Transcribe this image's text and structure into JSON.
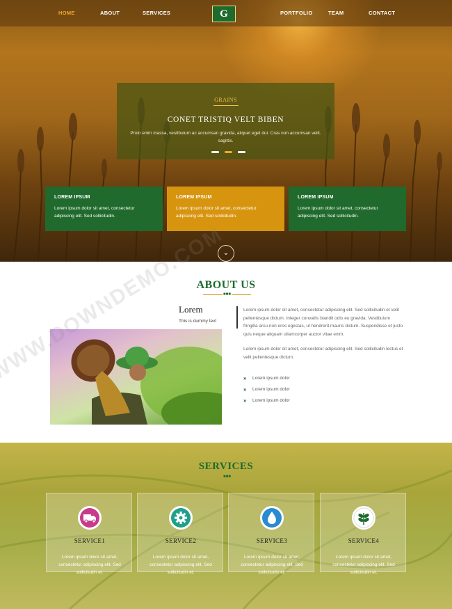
{
  "nav": {
    "items": [
      {
        "label": "HOME",
        "active": true
      },
      {
        "label": "ABOUT"
      },
      {
        "label": "SERVICES"
      },
      {
        "label": "PORTFOLIO"
      },
      {
        "label": "TEAM"
      },
      {
        "label": "CONTACT"
      }
    ],
    "logo_letter": "G"
  },
  "hero": {
    "kicker": "GRAINS",
    "title": "CONET TRISTIQ VELT BIBEN",
    "text": "Proin enim massa, vestibulum ac accumsan gravida, aliquet eget dui. Cras non accumsan velit. sagittis.",
    "slides": 3,
    "active_slide": 2
  },
  "features": [
    {
      "title": "LOREM IPSUM",
      "text": "Lorem ipsum dolor sit amet, consectetur adipiscing elit. Sed sollicitudin.",
      "color": "#1f6a2c"
    },
    {
      "title": "LOREM IPSUM",
      "text": "Lorem ipsum dolor sit amet, consectetur adipiscing elit. Sed sollicitudin.",
      "color": "#d7940f"
    },
    {
      "title": "LOREM IPSUM",
      "text": "Lorem ipsum dolor sit amet, consectetur adipiscing elit. Sed sollicitudin.",
      "color": "#1f6a2c"
    }
  ],
  "about": {
    "title": "ABOUT US",
    "lorem": "Lorem",
    "dummy": "This is dummy text",
    "para1": "Lorem ipsum dolor sit amet, consectetur adipiscing elit. Sed sollicitudin et velit pellentesque dictum. Integer convallis blandit odio eu gravida. Vestibulum fringilla arcu non eros egestas, ut hendrerit mauris dictum. Suspendisse et justo quis neque aliquam ullamcorper auctor vitae enim.",
    "para2": "Lorem ipsum dolor sit amet, consectetur adipiscing elit. Sed sollicitudin lectus et velit pellentesque dictum.",
    "list": [
      "Lorem ipsum dolor",
      "Lorem ipsum dolor",
      "Lorem ipsum dolor"
    ]
  },
  "services": {
    "title": "SERVICES",
    "items": [
      {
        "title": "SERVICE1",
        "icon": "truck-icon",
        "icon_color": "#c83a8a",
        "text": "Lorem ipsum dolor sit amet, consectetur adipiscing elit. Sed sollicitudin et."
      },
      {
        "title": "SERVICE2",
        "icon": "gear-icon",
        "icon_color": "#1fa08a",
        "text": "Lorem ipsum dolor sit amet, consectetur adipiscing elit. Sed sollicitudin et."
      },
      {
        "title": "SERVICE3",
        "icon": "water-drop-icon",
        "icon_color": "#2a8bd0",
        "text": "Lorem ipsum dolor sit amet, consectetur adipiscing elit. Sed sollicitudin et."
      },
      {
        "title": "SERVICE4",
        "icon": "leaf-icon",
        "icon_color": "#1e6b2d",
        "text": "Lorem ipsum dolor sit amet, consectetur adipiscing elit. Sed sollicitudin et."
      }
    ]
  },
  "watermark": "WWW.DOWNDEMO.COM"
}
